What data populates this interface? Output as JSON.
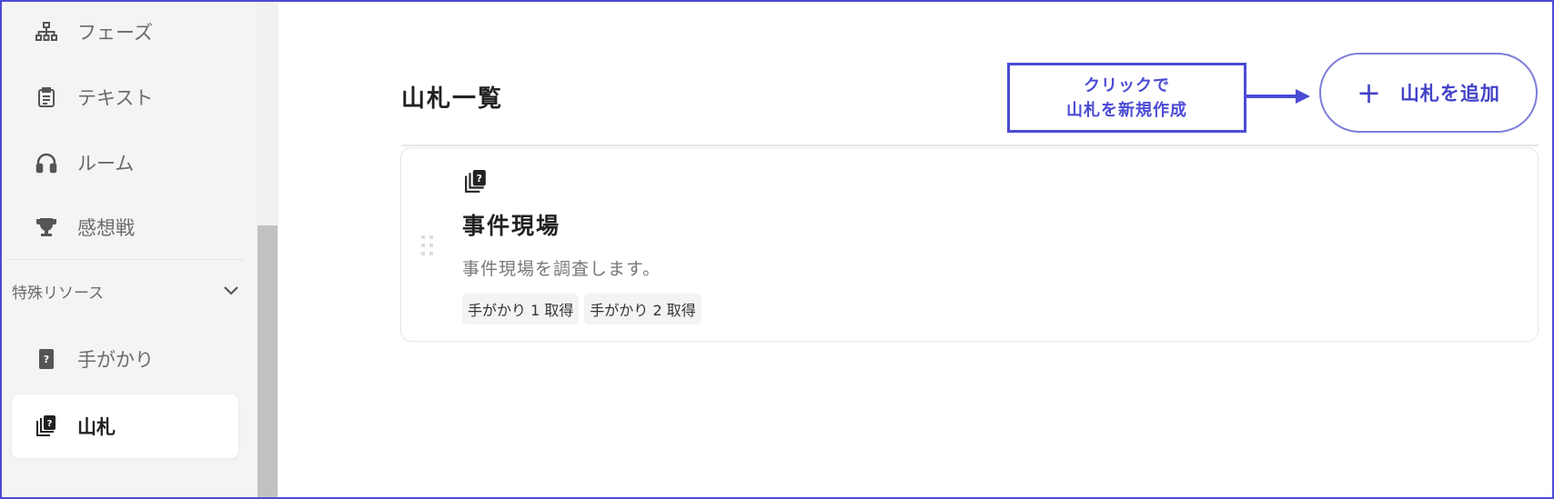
{
  "sidebar": {
    "items": [
      {
        "label": "フェーズ",
        "icon": "sitemap-icon"
      },
      {
        "label": "テキスト",
        "icon": "clipboard-icon"
      },
      {
        "label": "ルーム",
        "icon": "headphones-icon"
      },
      {
        "label": "感想戦",
        "icon": "trophy-icon"
      }
    ],
    "section": {
      "label": "特殊リソース",
      "expanded": true
    },
    "section_items": [
      {
        "label": "手がかり",
        "icon": "clue-card-icon"
      },
      {
        "label": "山札",
        "icon": "deck-icon",
        "active": true
      }
    ]
  },
  "main": {
    "title": "山札一覧",
    "add_button": "山札を追加",
    "add_icon": "+",
    "cards": [
      {
        "title": "事件現場",
        "description": "事件現場を調査します。",
        "tags": [
          "手がかり 1 取得",
          "手がかり 2 取得"
        ]
      }
    ]
  },
  "annotation": {
    "line1": "クリックで",
    "line2": "山札を新規作成"
  },
  "colors": {
    "accent": "#4b4bd6",
    "sidebar_bg": "#f4f4f4"
  }
}
